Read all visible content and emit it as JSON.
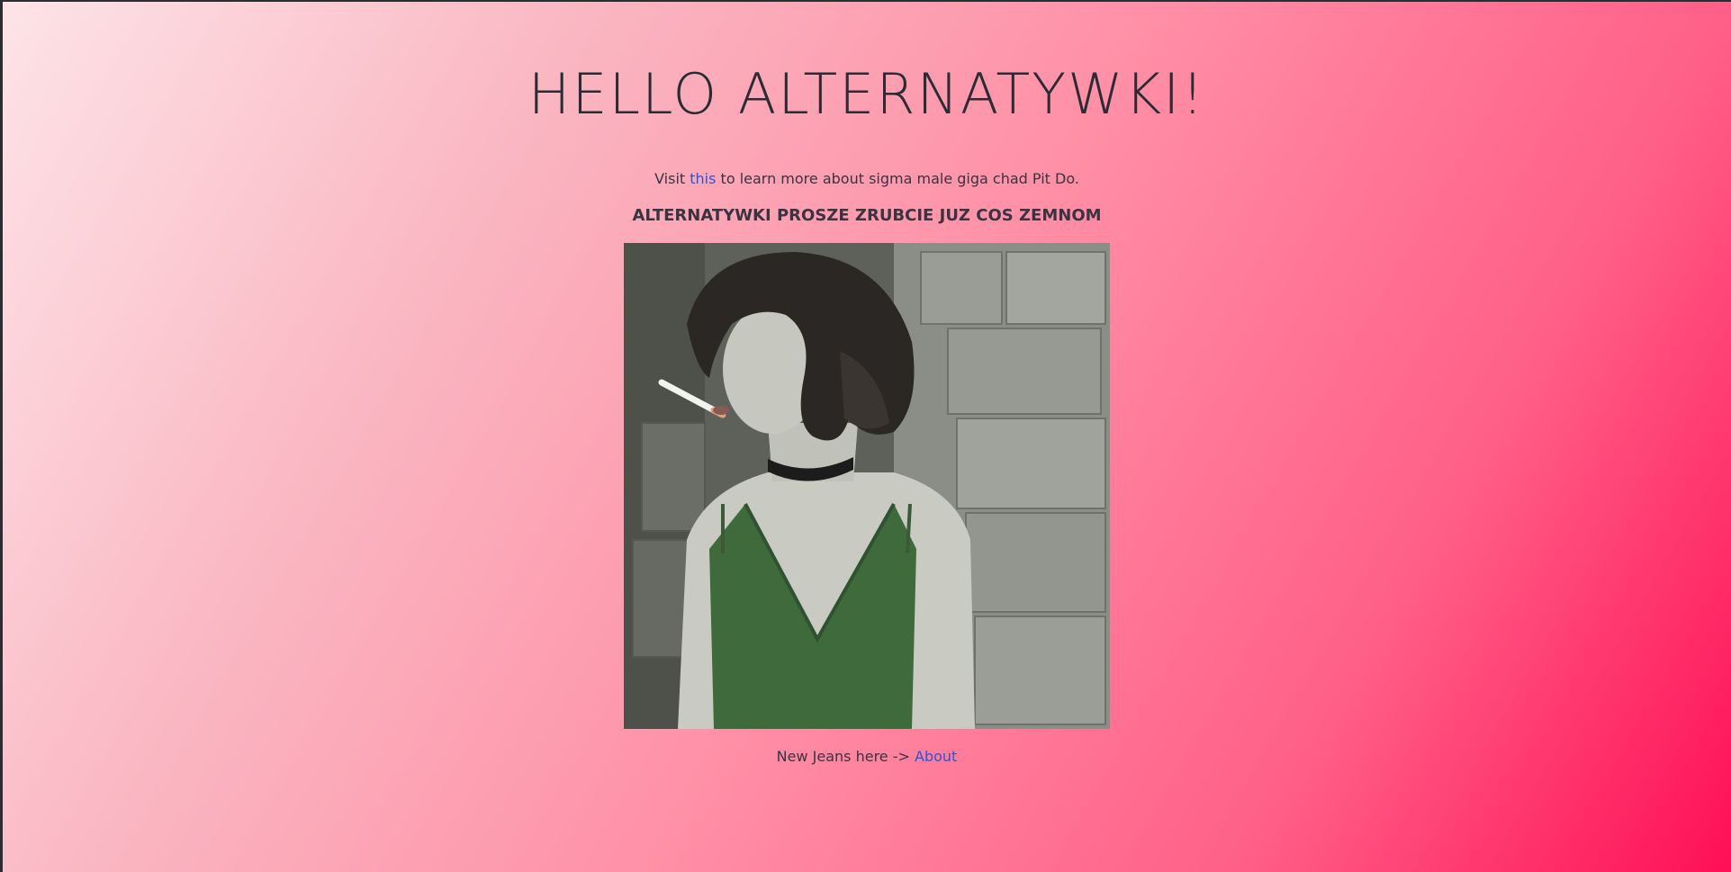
{
  "header": {
    "title": "HELLO ALTERNATYWKI!"
  },
  "intro": {
    "prefix": "Visit ",
    "link_label": "this",
    "suffix": " to learn more about sigma male giga chad Pit Do."
  },
  "subtitle": "ALTERNATYWKI PROSZE ZRUBCIE JUZ COS ZEMNOM",
  "photo": {
    "subject": "portrait photo of a woman with short dark hair and a cigarette, wearing a green top, in front of cardboard boxes"
  },
  "footer": {
    "prefix": "New Jeans here -> ",
    "link_label": "About"
  },
  "colors": {
    "link": "#2b55d6",
    "gradient_start": "#fde4e7",
    "gradient_end": "#ff0f56"
  }
}
